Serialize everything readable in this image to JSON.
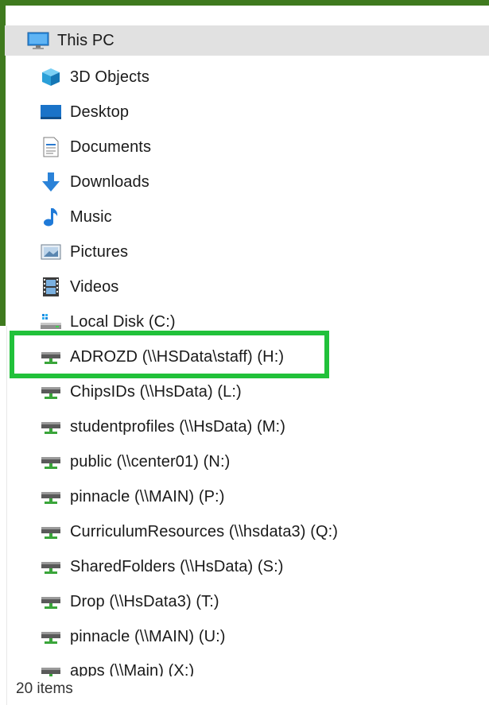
{
  "window": {
    "accent_color": "#3f7a1e",
    "highlight_color": "#21c13a"
  },
  "tree": {
    "root": {
      "label": "This PC",
      "icon": "monitor-icon"
    },
    "folders": [
      {
        "label": "3D Objects",
        "icon": "3d-objects-icon"
      },
      {
        "label": "Desktop",
        "icon": "desktop-icon"
      },
      {
        "label": "Documents",
        "icon": "documents-icon"
      },
      {
        "label": "Downloads",
        "icon": "download-arrow-icon"
      },
      {
        "label": "Music",
        "icon": "music-note-icon"
      },
      {
        "label": "Pictures",
        "icon": "pictures-icon"
      },
      {
        "label": "Videos",
        "icon": "film-icon"
      }
    ],
    "drives": [
      {
        "label": "Local Disk (C:)",
        "icon": "local-disk-icon"
      },
      {
        "label": "ADROZD (\\\\HSData\\staff) (H:)",
        "icon": "network-drive-icon"
      },
      {
        "label": "ChipsIDs (\\\\HsData) (L:)",
        "icon": "network-drive-icon"
      },
      {
        "label": "studentprofiles (\\\\HsData) (M:)",
        "icon": "network-drive-icon"
      },
      {
        "label": "public (\\\\center01) (N:)",
        "icon": "network-drive-icon"
      },
      {
        "label": "pinnacle (\\\\MAIN) (P:)",
        "icon": "network-drive-icon"
      },
      {
        "label": "CurriculumResources (\\\\hsdata3) (Q:)",
        "icon": "network-drive-icon"
      },
      {
        "label": "SharedFolders (\\\\HsData) (S:)",
        "icon": "network-drive-icon"
      },
      {
        "label": "Drop (\\\\HsData3) (T:)",
        "icon": "network-drive-icon"
      },
      {
        "label": "pinnacle (\\\\MAIN) (U:)",
        "icon": "network-drive-icon"
      },
      {
        "label": "apps (\\\\Main) (X:)",
        "icon": "network-drive-icon"
      }
    ]
  },
  "status_bar": {
    "item_count": "20 items"
  }
}
